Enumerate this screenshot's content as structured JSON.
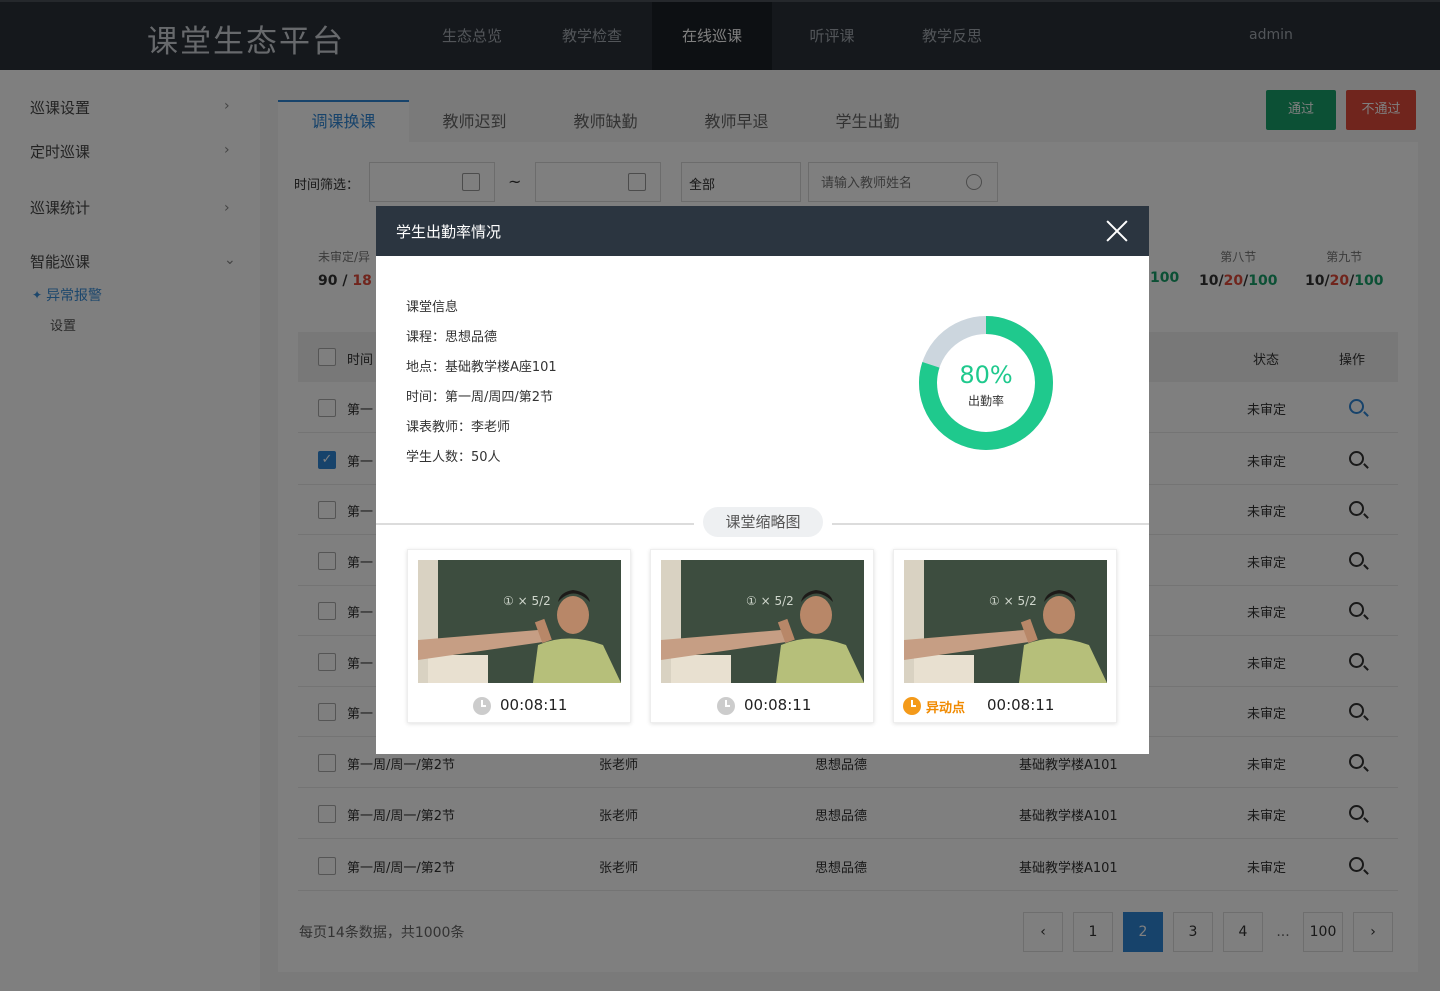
{
  "brand": "课堂生态平台",
  "nav": [
    "生态总览",
    "教学检查",
    "在线巡课",
    "听评课",
    "教学反思"
  ],
  "user": "admin",
  "sidebar": {
    "groups": [
      "巡课设置",
      "定时巡课",
      "巡课统计",
      "智能巡课"
    ],
    "active_sub": "异常报警",
    "sub": "设置"
  },
  "tabs": [
    "调课换课",
    "教师迟到",
    "教师缺勤",
    "教师早退",
    "学生出勤"
  ],
  "buttons": {
    "pass": "通过",
    "fail": "不通过"
  },
  "filter": {
    "label": "时间筛选：",
    "tilde": "~",
    "select": "全部",
    "search_placeholder": "请输入教师姓名"
  },
  "stats": [
    {
      "label": "未审定/异",
      "a": "90",
      "sep": "/",
      "b": "18"
    },
    {
      "label": "第八节",
      "a": "10",
      "b": "20",
      "c": "100"
    },
    {
      "label": "第九节",
      "a": "10",
      "b": "20",
      "c": "100"
    },
    {
      "partial": "100"
    }
  ],
  "table": {
    "headers": {
      "time": "时间",
      "status": "状态",
      "op": "操作"
    },
    "hidden_rows": [
      {
        "time": "第一",
        "status": "未审定"
      },
      {
        "time": "第一",
        "status": "未审定"
      },
      {
        "time": "第一",
        "status": "未审定"
      },
      {
        "time": "第一",
        "status": "未审定"
      },
      {
        "time": "第一",
        "status": "未审定"
      },
      {
        "time": "第一",
        "status": "未审定"
      },
      {
        "time": "第一",
        "status": "未审定"
      }
    ],
    "rows": [
      {
        "time": "第一周/周一/第2节",
        "teacher": "张老师",
        "course": "思想品德",
        "place": "基础教学楼A101",
        "status": "未审定"
      },
      {
        "time": "第一周/周一/第2节",
        "teacher": "张老师",
        "course": "思想品德",
        "place": "基础教学楼A101",
        "status": "未审定"
      },
      {
        "time": "第一周/周一/第2节",
        "teacher": "张老师",
        "course": "思想品德",
        "place": "基础教学楼A101",
        "status": "未审定"
      }
    ]
  },
  "footer": {
    "info": "每页14条数据，共1000条",
    "pages": [
      "1",
      "2",
      "3",
      "4",
      "...",
      "100"
    ],
    "prev": "‹",
    "next": "›"
  },
  "modal": {
    "title": "学生出勤率情况",
    "info": [
      "课堂信息",
      "课程：思想品德",
      "地点：基础教学楼A座101",
      "时间：第一周/周四/第2节",
      "课表教师：李老师",
      "学生人数：50人"
    ],
    "rate": "80%",
    "rate_value": 0.8,
    "rate_label": "出勤率",
    "thumb_title": "课堂缩略图",
    "thumbs": [
      {
        "time": "00:08:11"
      },
      {
        "time": "00:08:11"
      },
      {
        "time": "00:08:11",
        "anomaly": "异动点"
      }
    ]
  },
  "colors": {
    "accent": "#2f86d6",
    "pass": "#19a06a",
    "fail": "#e04a3a",
    "rate": "#1fc98d"
  }
}
